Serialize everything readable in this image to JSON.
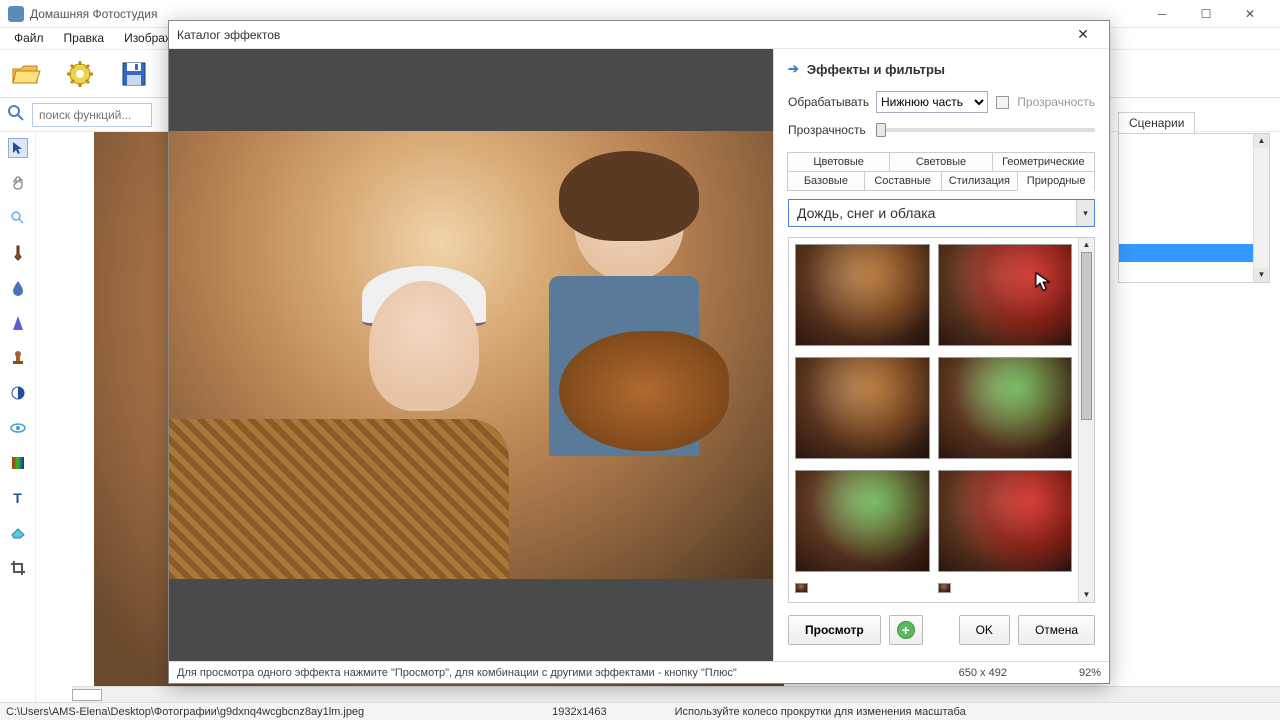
{
  "main_window": {
    "title": "Домашняя Фотостудия",
    "menu": {
      "file": "Файл",
      "edit": "Правка",
      "image": "Изображени"
    },
    "search_placeholder": "поиск функций...",
    "right_panel_tab": "Сценарии"
  },
  "dialog": {
    "title": "Каталог эффектов",
    "header": "Эффекты и фильтры",
    "process_label": "Обрабатывать",
    "process_value": "Нижнюю часть",
    "transparency_chk": "Прозрачность",
    "opacity_label": "Прозрачность",
    "tabs_row1": {
      "color": "Цветовые",
      "light": "Световые",
      "geom": "Геометрические"
    },
    "tabs_row2": {
      "basic": "Базовые",
      "composite": "Составные",
      "style": "Стилизация",
      "nature": "Природные"
    },
    "effect_group": "Дождь, снег и облака",
    "buttons": {
      "preview": "Просмотр",
      "ok": "OK",
      "cancel": "Отмена"
    },
    "status_hint": "Для просмотра одного эффекта нажмите \"Просмотр\", для комбинации с другими эффектами - кнопку \"Плюс\"",
    "status_size": "650 x 492",
    "status_zoom": "92%"
  },
  "main_status": {
    "path": "C:\\Users\\AMS-Elena\\Desktop\\Фотографии\\g9dxnq4wcgbcnz8ay1lm.jpeg",
    "dims": "1932x1463",
    "hint": "Используйте колесо прокрутки для изменения масштаба"
  },
  "icons": {
    "open": "#e8a030",
    "gear": "#d8b020",
    "save": "#2060c0"
  }
}
